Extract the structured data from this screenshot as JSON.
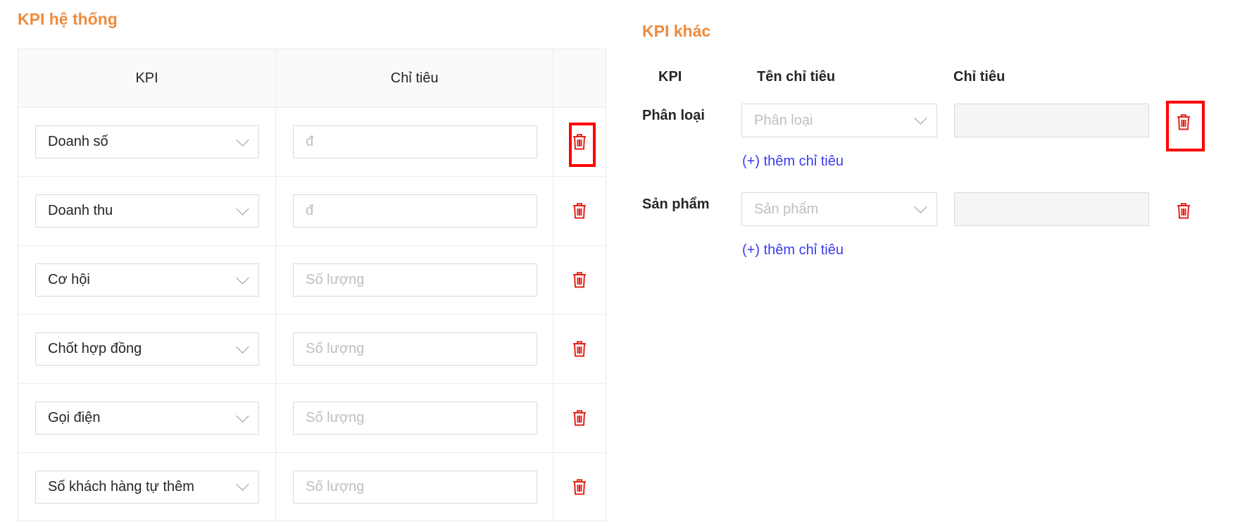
{
  "system_kpi": {
    "title": "KPI hệ thống",
    "columns": [
      "KPI",
      "Chỉ tiêu",
      ""
    ],
    "rows": [
      {
        "kpi": "Doanh số",
        "target_placeholder": "đ"
      },
      {
        "kpi": "Doanh thu",
        "target_placeholder": "đ"
      },
      {
        "kpi": "Cơ hội",
        "target_placeholder": "Số lượng"
      },
      {
        "kpi": "Chốt hợp đồng",
        "target_placeholder": "Số lượng"
      },
      {
        "kpi": "Gọi điện",
        "target_placeholder": "Số lượng"
      },
      {
        "kpi": "Số khách hàng tự thêm",
        "target_placeholder": "Số lượng"
      }
    ]
  },
  "other_kpi": {
    "title": "KPI khác",
    "columns": [
      "KPI",
      "Tên chỉ tiêu",
      "Chỉ tiêu"
    ],
    "rows": [
      {
        "label": "Phân loại",
        "name_placeholder": "Phân loại",
        "target_value": "",
        "add_link": "(+) thêm chỉ tiêu"
      },
      {
        "label": "Sản phẩm",
        "name_placeholder": "Sản phẩm",
        "target_value": "",
        "add_link": "(+) thêm chỉ tiêu"
      }
    ]
  },
  "icons": {
    "delete": "trash-icon",
    "dropdown": "chevron-down-icon"
  },
  "colors": {
    "section_title": "#ed8b3e",
    "delete_icon": "#e2231a",
    "link": "#3b3bf0",
    "highlight": "#ff0000"
  }
}
